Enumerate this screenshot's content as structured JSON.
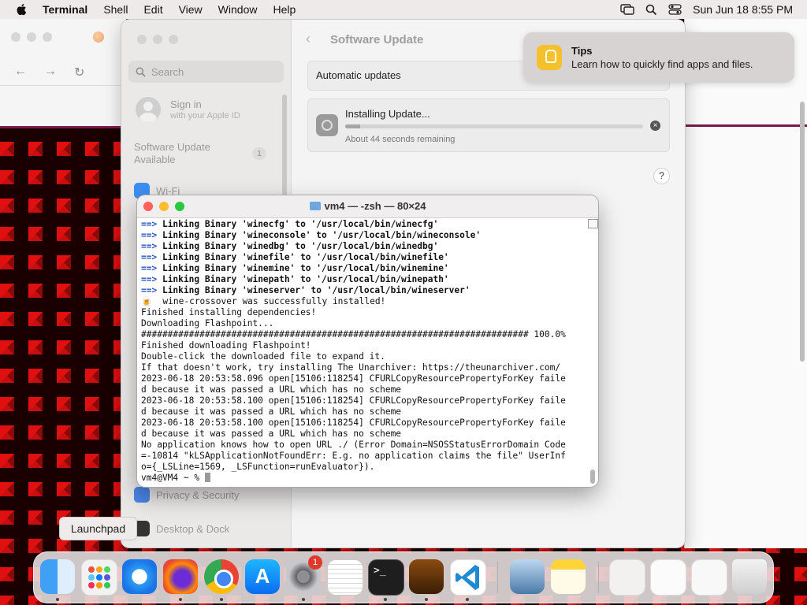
{
  "menubar": {
    "app_name": "Terminal",
    "items": [
      "Shell",
      "Edit",
      "View",
      "Window",
      "Help"
    ],
    "datetime": "Sun Jun 18  8:55 PM"
  },
  "settings": {
    "search_placeholder": "Search",
    "signin_title": "Sign in",
    "signin_subtitle": "with your Apple ID",
    "software_update_available": "Software Update Available",
    "software_update_badge": "1",
    "sidebar_items": [
      "Wi-Fi",
      "Privacy & Security",
      "Desktop & Dock"
    ],
    "page_title": "Software Update",
    "automatic_updates": "Automatic updates",
    "installing_label": "Installing Update...",
    "remaining": "About 44 seconds remaining",
    "progress_fraction": 0.05,
    "help": "?"
  },
  "tips": {
    "title": "Tips",
    "body": "Learn how to quickly find apps and files."
  },
  "terminal": {
    "title": "vm4 — -zsh — 80×24",
    "lines": [
      {
        "prefix": "==>",
        "text": " Linking Binary 'winecfg' to '/usr/local/bin/winecfg'",
        "bold": true
      },
      {
        "prefix": "==>",
        "text": " Linking Binary 'wineconsole' to '/usr/local/bin/wineconsole'",
        "bold": true
      },
      {
        "prefix": "==>",
        "text": " Linking Binary 'winedbg' to '/usr/local/bin/winedbg'",
        "bold": true
      },
      {
        "prefix": "==>",
        "text": " Linking Binary 'winefile' to '/usr/local/bin/winefile'",
        "bold": true
      },
      {
        "prefix": "==>",
        "text": " Linking Binary 'winemine' to '/usr/local/bin/winemine'",
        "bold": true
      },
      {
        "prefix": "==>",
        "text": " Linking Binary 'winepath' to '/usr/local/bin/winepath'",
        "bold": true
      },
      {
        "prefix": "==>",
        "text": " Linking Binary 'wineserver' to '/usr/local/bin/wineserver'",
        "bold": true
      },
      {
        "prefix": "🍺",
        "text": "  wine-crossover was successfully installed!",
        "bold": false
      },
      {
        "prefix": "",
        "text": "Finished installing dependencies!",
        "bold": false
      },
      {
        "prefix": "",
        "text": "Downloading Flashpoint...",
        "bold": false
      },
      {
        "prefix": "",
        "text": "######################################################################### 100.0%",
        "bold": false
      },
      {
        "prefix": "",
        "text": "Finished downloading Flashpoint!",
        "bold": false
      },
      {
        "prefix": "",
        "text": "Double-click the downloaded file to expand it.",
        "bold": false
      },
      {
        "prefix": "",
        "text": "If that doesn't work, try installing The Unarchiver: https://theunarchiver.com/",
        "bold": false
      },
      {
        "prefix": "",
        "text": "2023-06-18 20:53:58.096 open[15106:118254] CFURLCopyResourcePropertyForKey faile",
        "bold": false
      },
      {
        "prefix": "",
        "text": "d because it was passed a URL which has no scheme",
        "bold": false
      },
      {
        "prefix": "",
        "text": "2023-06-18 20:53:58.100 open[15106:118254] CFURLCopyResourcePropertyForKey faile",
        "bold": false
      },
      {
        "prefix": "",
        "text": "d because it was passed a URL which has no scheme",
        "bold": false
      },
      {
        "prefix": "",
        "text": "2023-06-18 20:53:58.100 open[15106:118254] CFURLCopyResourcePropertyForKey faile",
        "bold": false
      },
      {
        "prefix": "",
        "text": "d because it was passed a URL which has no scheme",
        "bold": false
      },
      {
        "prefix": "",
        "text": "No application knows how to open URL ./ (Error Domain=NSOSStatusErrorDomain Code",
        "bold": false
      },
      {
        "prefix": "",
        "text": "=-10814 \"kLSApplicationNotFoundErr: E.g. no application claims the file\" UserInf",
        "bold": false
      },
      {
        "prefix": "",
        "text": "o={_LSLine=1569, _LSFunction=runEvaluator}).",
        "bold": false
      }
    ],
    "prompt": "vm4@VM4 ~ % "
  },
  "dock": {
    "tooltip": "Launchpad",
    "settings_badge": "1",
    "apps": [
      "Finder",
      "Launchpad",
      "Safari",
      "Firefox",
      "Google Chrome",
      "App Store",
      "System Settings",
      "TextEdit",
      "Terminal",
      "CrossOver",
      "Visual Studio Code",
      "Preview",
      "Notes"
    ]
  },
  "colors": {
    "menubar_bg": "#efeaea",
    "terminal_prompt_arrow": "#2a56c6",
    "close": "#ff5f57",
    "minimize": "#febc2e",
    "zoom": "#28c840"
  }
}
